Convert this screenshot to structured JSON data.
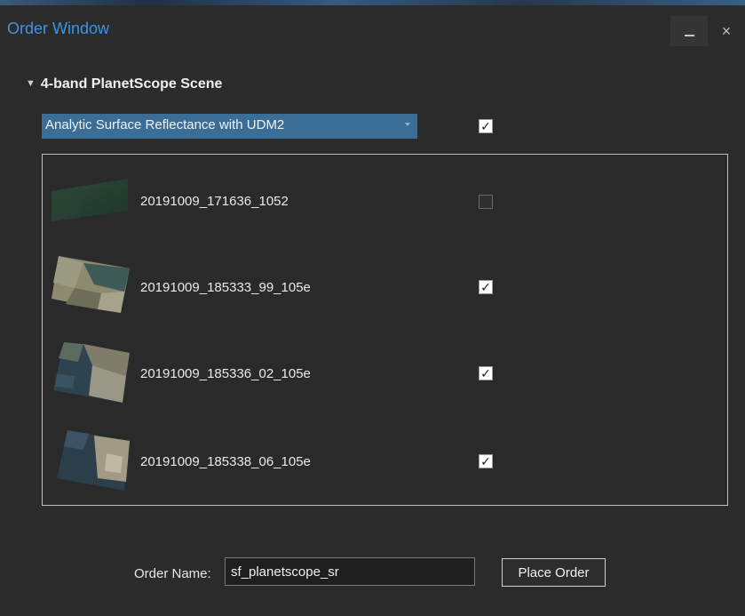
{
  "window": {
    "title": "Order Window",
    "minimize_glyph": "",
    "close_glyph": "×"
  },
  "section": {
    "chevron_icon": "chevron-down-icon",
    "title": "4-band PlanetScope Scene",
    "chevron_glyph": "⌄"
  },
  "product": {
    "selected": "Analytic Surface Reflectance with UDM2",
    "select_all_checked": true
  },
  "scenes": [
    {
      "id": "20191009_171636_1052",
      "checked": false
    },
    {
      "id": "20191009_185333_99_105e",
      "checked": true
    },
    {
      "id": "20191009_185336_02_105e",
      "checked": true
    },
    {
      "id": "20191009_185338_06_105e",
      "checked": true
    }
  ],
  "order": {
    "label": "Order Name:",
    "name": "sf_planetscope_sr",
    "button_label": "Place Order"
  },
  "colors": {
    "title": "#3f93e6",
    "dropdown_bg": "#3b6e96",
    "window_bg": "#2b2b2b"
  }
}
